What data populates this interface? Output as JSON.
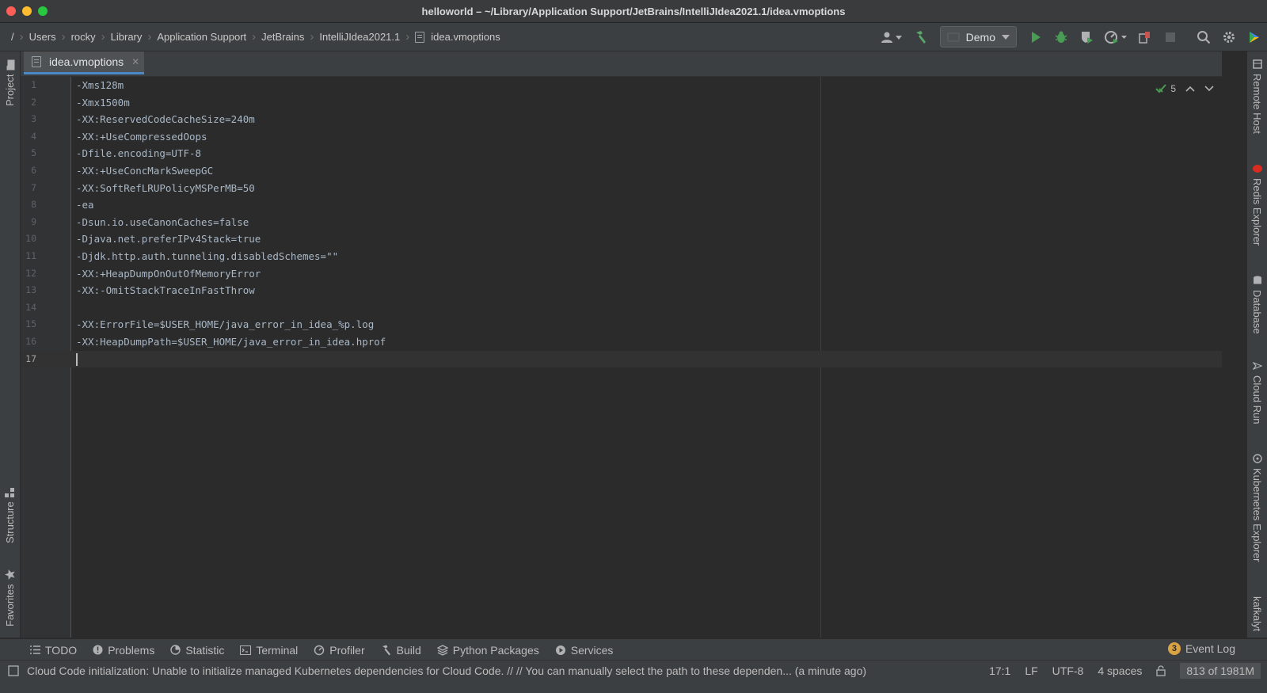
{
  "window": {
    "title": "helloworld – ~/Library/Application Support/JetBrains/IntelliJIdea2021.1/idea.vmoptions"
  },
  "breadcrumbs": [
    "/",
    "Users",
    "rocky",
    "Library",
    "Application Support",
    "JetBrains",
    "IntelliJIdea2021.1",
    "idea.vmoptions"
  ],
  "toolbar": {
    "run_config": "Demo"
  },
  "left_tabs": {
    "project": "Project",
    "structure": "Structure",
    "favorites": "Favorites"
  },
  "right_tabs": {
    "remote_host": "Remote Host",
    "redis": "Redis Explorer",
    "database": "Database",
    "cloud_run": "Cloud Run",
    "kubernetes": "Kubernetes Explorer",
    "kafka": "kafkalyt"
  },
  "editor": {
    "tab_name": "idea.vmoptions",
    "inspection_count": "5",
    "lines": [
      {
        "n": "1",
        "text": "-Xms128m"
      },
      {
        "n": "2",
        "text": "-Xmx1500m"
      },
      {
        "n": "3",
        "text": "-XX:ReservedCodeCacheSize=240m"
      },
      {
        "n": "4",
        "text": "-XX:+UseCompressedOops"
      },
      {
        "n": "5",
        "text": "-Dfile.encoding=UTF-8"
      },
      {
        "n": "6",
        "text": "-XX:+UseConcMarkSweepGC"
      },
      {
        "n": "7",
        "text": "-XX:SoftRefLRUPolicyMSPerMB=50"
      },
      {
        "n": "8",
        "text": "-ea"
      },
      {
        "n": "9",
        "text": "-Dsun.io.useCanonCaches=false"
      },
      {
        "n": "10",
        "text": "-Djava.net.preferIPv4Stack=true"
      },
      {
        "n": "11",
        "text": "-Djdk.http.auth.tunneling.disabledSchemes=\"\""
      },
      {
        "n": "12",
        "text": "-XX:+HeapDumpOnOutOfMemoryError"
      },
      {
        "n": "13",
        "text": "-XX:-OmitStackTraceInFastThrow"
      },
      {
        "n": "14",
        "text": ""
      },
      {
        "n": "15",
        "text": "-XX:ErrorFile=$USER_HOME/java_error_in_idea_%p.log"
      },
      {
        "n": "16",
        "text": "-XX:HeapDumpPath=$USER_HOME/java_error_in_idea.hprof"
      },
      {
        "n": "17",
        "text": ""
      }
    ]
  },
  "tool_windows": {
    "todo": "TODO",
    "problems": "Problems",
    "statistic": "Statistic",
    "terminal": "Terminal",
    "profiler": "Profiler",
    "build": "Build",
    "python_packages": "Python Packages",
    "services": "Services",
    "event_log": "Event Log",
    "event_log_count": "3"
  },
  "status": {
    "message": "Cloud Code initialization: Unable to initialize managed Kubernetes dependencies for Cloud Code. // // You can manually select the path to these dependen... (a minute ago)",
    "position": "17:1",
    "line_sep": "LF",
    "encoding": "UTF-8",
    "indent": "4 spaces",
    "memory": "813 of 1981M"
  },
  "colors": {
    "accent": "#4a88c7",
    "run_green": "#499c54",
    "editor_bg": "#2b2b2b",
    "panel_bg": "#3c3f41"
  }
}
